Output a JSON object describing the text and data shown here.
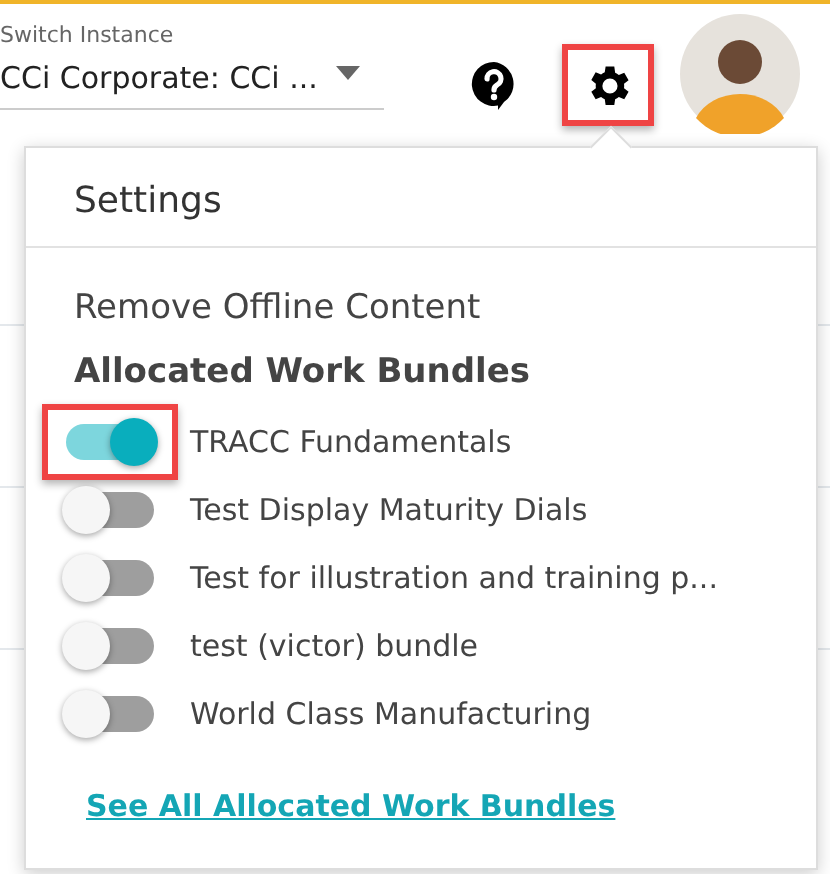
{
  "instance": {
    "label": "Switch Instance",
    "value": "CCi Corporate: CCi ..."
  },
  "toolbar": {
    "help_highlighted": false,
    "settings_highlighted": true
  },
  "settings_menu": {
    "title": "Settings",
    "actions": [
      "Remove Offline Content"
    ],
    "section_title": "Allocated Work Bundles",
    "bundles": [
      {
        "label": "TRACC Fundamentals",
        "on": true,
        "highlighted": true
      },
      {
        "label": "Test Display Maturity Dials",
        "on": false,
        "highlighted": false
      },
      {
        "label": "Test for illustration and training p...",
        "on": false,
        "highlighted": false
      },
      {
        "label": "test (victor) bundle",
        "on": false,
        "highlighted": false
      },
      {
        "label": "World Class Manufacturing",
        "on": false,
        "highlighted": false
      }
    ],
    "link": "See All Allocated Work Bundles"
  }
}
